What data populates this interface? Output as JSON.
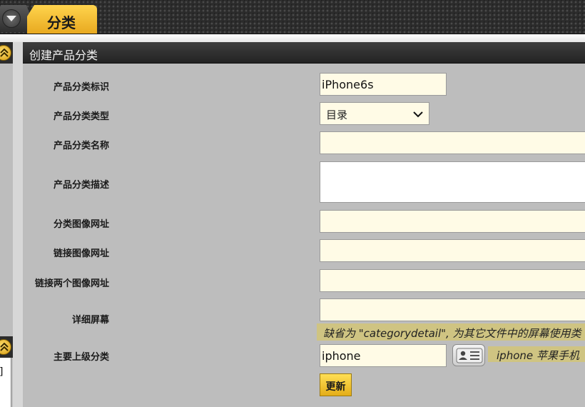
{
  "header": {
    "tab_title": "分类"
  },
  "side": {
    "bracket_text": "]"
  },
  "panel": {
    "title": "创建产品分类"
  },
  "form": {
    "category_id": {
      "label": "产品分类标识",
      "value": "iPhone6s"
    },
    "category_type": {
      "label": "产品分类类型",
      "value": "目录"
    },
    "category_name": {
      "label": "产品分类名称",
      "value": ""
    },
    "category_desc": {
      "label": "产品分类描述",
      "value": ""
    },
    "category_image_url": {
      "label": "分类图像网址",
      "value": ""
    },
    "link_image_url": {
      "label": "链接图像网址",
      "value": ""
    },
    "link_two_image_url": {
      "label": "链接两个图像网址",
      "value": ""
    },
    "detail_screen": {
      "label": "详细屏幕",
      "value": "",
      "hint": "缺省为 \"categorydetail\", 为其它文件中的屏幕使用类"
    },
    "primary_parent": {
      "label": "主要上级分类",
      "value": "iphone",
      "description": "iphone 苹果手机"
    },
    "update_label": "更新"
  },
  "colors": {
    "accent": "#f2bd2e",
    "field_bg": "#fffbe6",
    "hint_bg": "#cfc482",
    "page_bg": "#bdbdbd"
  }
}
